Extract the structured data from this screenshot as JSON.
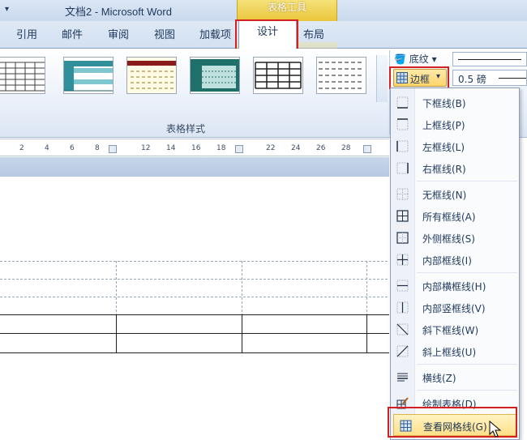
{
  "window": {
    "title": "文档2 - Microsoft Word",
    "context_group": "表格工具"
  },
  "tabs": [
    {
      "label": "引用"
    },
    {
      "label": "邮件"
    },
    {
      "label": "审阅"
    },
    {
      "label": "视图"
    },
    {
      "label": "加载项"
    },
    {
      "label": "设计",
      "active": true
    },
    {
      "label": "布局"
    }
  ],
  "ribbon": {
    "table_styles_group": "表格样式",
    "shading_label": "底纹",
    "border_label": "边框",
    "line_weight": "0.5 磅"
  },
  "ruler": {
    "numbers": [
      "2",
      "4",
      "6",
      "8",
      "12",
      "14",
      "16",
      "18",
      "22",
      "24",
      "26",
      "28"
    ]
  },
  "border_menu": {
    "items": [
      {
        "label": "下框线(B)",
        "icon": "bottom-border-icon"
      },
      {
        "label": "上框线(P)",
        "icon": "top-border-icon"
      },
      {
        "label": "左框线(L)",
        "icon": "left-border-icon"
      },
      {
        "label": "右框线(R)",
        "icon": "right-border-icon"
      },
      {
        "label": "无框线(N)",
        "icon": "no-border-icon"
      },
      {
        "label": "所有框线(A)",
        "icon": "all-borders-icon"
      },
      {
        "label": "外侧框线(S)",
        "icon": "outside-borders-icon"
      },
      {
        "label": "内部框线(I)",
        "icon": "inside-borders-icon"
      },
      {
        "label": "内部横框线(H)",
        "icon": "inside-horizontal-border-icon"
      },
      {
        "label": "内部竖框线(V)",
        "icon": "inside-vertical-border-icon"
      },
      {
        "label": "斜下框线(W)",
        "icon": "diagonal-down-border-icon"
      },
      {
        "label": "斜上框线(U)",
        "icon": "diagonal-up-border-icon"
      },
      {
        "label": "横线(Z)",
        "icon": "horizontal-line-icon"
      },
      {
        "label": "绘制表格(D)",
        "icon": "draw-table-icon"
      },
      {
        "label": "查看网格线(G)",
        "icon": "view-gridlines-icon"
      }
    ]
  },
  "colors": {
    "highlight_red": "#d32020",
    "context_gold": "#e9c53a",
    "ribbon_blue": "#dfe9f5"
  }
}
